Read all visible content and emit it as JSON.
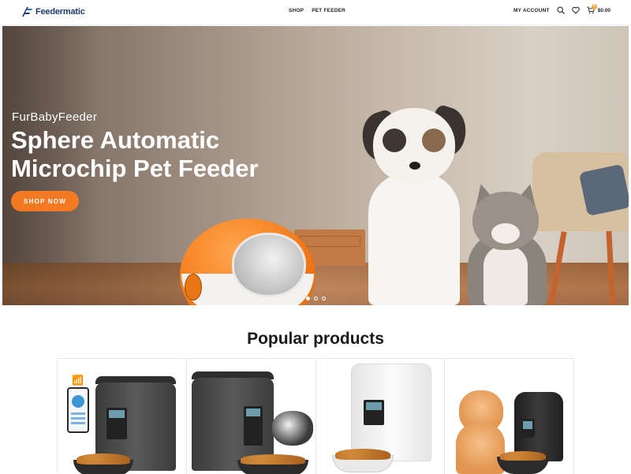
{
  "header": {
    "logo_text": "Feedermatic",
    "nav": [
      {
        "label": "SHOP"
      },
      {
        "label": "PET FEEDER"
      }
    ],
    "account_label": "MY ACCOUNT",
    "cart_count": "0",
    "cart_total": "$0.00"
  },
  "hero": {
    "brand": "FurBabyFeeder",
    "title": "Sphere Automatic Microchip Pet Feeder",
    "cta_label": "SHOP NOW",
    "slides_total": 3,
    "active_slide": 1
  },
  "products": {
    "title": "Popular products"
  },
  "icons": {
    "search": "search-icon",
    "wishlist": "heart-icon",
    "cart": "cart-icon"
  },
  "colors": {
    "accent": "#f37a22",
    "logo": "#1b3a6b",
    "cart_badge": "#f0a43a"
  }
}
